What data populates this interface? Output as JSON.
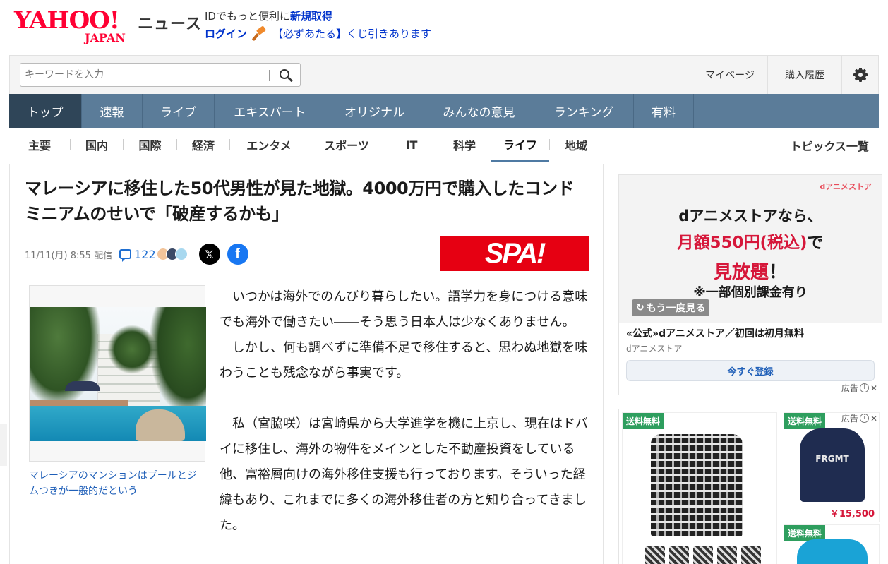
{
  "header": {
    "logo_text": "YAHOO!",
    "logo_sub": "JAPAN",
    "service": "ニュース",
    "id_prefix": "IDでもっと便利に",
    "register_link": "新規取得",
    "login_link": "ログイン",
    "lottery_text": "【必ずあたる】くじ引きあります"
  },
  "search": {
    "placeholder": "キーワードを入力"
  },
  "utility": {
    "mypage": "マイページ",
    "history": "購入履歴"
  },
  "main_nav": [
    {
      "label": "トップ",
      "active": true
    },
    {
      "label": "速報"
    },
    {
      "label": "ライブ"
    },
    {
      "label": "エキスパート"
    },
    {
      "label": "オリジナル"
    },
    {
      "label": "みんなの意見"
    },
    {
      "label": "ランキング"
    },
    {
      "label": "有料"
    }
  ],
  "sub_nav": [
    {
      "label": "主要"
    },
    {
      "label": "国内"
    },
    {
      "label": "国際"
    },
    {
      "label": "経済"
    },
    {
      "label": "エンタメ"
    },
    {
      "label": "スポーツ"
    },
    {
      "label": "IT"
    },
    {
      "label": "科学"
    },
    {
      "label": "ライフ",
      "active": true
    },
    {
      "label": "地域"
    }
  ],
  "topics_link": "トピックス一覧",
  "article": {
    "title": "マレーシアに移住した50代男性が見た地獄。4000万円で購入したコンドミニアムのせいで「破産するかも」",
    "date": "11/11(月) 8:55 配信",
    "comment_count": "122",
    "x_label": "𝕏",
    "fb_label": "f",
    "publisher_logo": "SPA!",
    "photo_caption": "マレーシアのマンションはプールとジムつきが一般的だという",
    "paragraphs": [
      "いつかは海外でのんびり暮らしたい。語学力を身につける意味でも海外で働きたい――そう思う日本人は少なくありません。",
      "しかし、何も調べずに準備不足で移住すると、思わぬ地獄を味わうことも残念ながら事実です。",
      "私（宮脇咲）は宮崎県から大学進学を機に上京し、現在はドバイに移住し、海外の物件をメインとした不動産投資をしている他、富裕層向けの海外移住支援も行っております。そういった経緯もあり、これまでに多くの海外移住者の方と知り合ってきました。"
    ]
  },
  "ad1": {
    "brand": "dアニメストア",
    "line1": "dアニメストアなら、",
    "line2_red": "月額550円(税込)",
    "line2_black": "で",
    "line3_red": "見放題",
    "line3_black": "！",
    "line4": "※一部個別課金有り",
    "replay": "もう一度見る",
    "title": "«公式»dアニメストア／初回は初月無料",
    "sponsor": "dアニメストア",
    "button": "今すぐ登録",
    "ad_label": "広告"
  },
  "ad2": {
    "badge": "送料無料",
    "hoodie_text": "FRGMT",
    "price": "￥15,500",
    "ad_label": "広告"
  }
}
